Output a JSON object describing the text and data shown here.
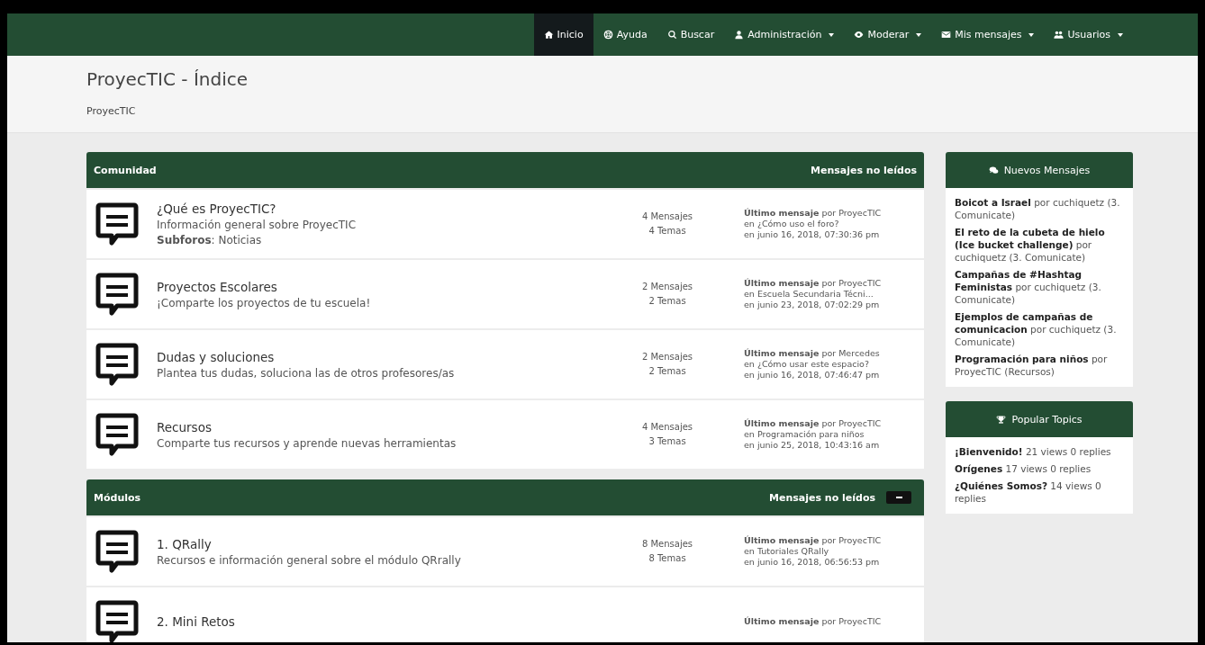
{
  "nav": {
    "items": [
      {
        "kind": "home",
        "label": "Inicio",
        "dropdown": false,
        "selected": true
      },
      {
        "kind": "lifebuoy",
        "label": "Ayuda",
        "dropdown": false,
        "selected": false
      },
      {
        "kind": "search",
        "label": "Buscar",
        "dropdown": false,
        "selected": false
      },
      {
        "kind": "user",
        "label": "Administración",
        "dropdown": true,
        "selected": false
      },
      {
        "kind": "eye",
        "label": "Moderar",
        "dropdown": true,
        "selected": false
      },
      {
        "kind": "envelope",
        "label": "Mis mensajes",
        "dropdown": true,
        "selected": false
      },
      {
        "kind": "users",
        "label": "Usuarios",
        "dropdown": true,
        "selected": false
      }
    ]
  },
  "header": {
    "title": "ProyecTIC - Índice",
    "breadcrumb": "ProyecTIC"
  },
  "categories": [
    {
      "title": "Comunidad",
      "unread_label": "Mensajes no leídos",
      "collapsible": false,
      "boards": [
        {
          "title": "¿Qué es ProyecTIC?",
          "description": "Información general sobre ProyecTIC",
          "subboards": "**Subforos**: Noticias",
          "posts": "4 Mensajes",
          "topics": "4 Temas",
          "last_post": [
            "**Último mensaje** por ProyecTIC",
            "en ¿Cómo uso el foro?",
            "en junio 16, 2018, 07:30:36 pm"
          ]
        },
        {
          "title": "Proyectos Escolares",
          "description": "¡Comparte los proyectos de tu escuela!",
          "posts": "2 Mensajes",
          "topics": "2 Temas",
          "last_post": [
            "**Último mensaje** por ProyecTIC",
            "en Escuela Secundaria Técni...",
            "en junio 23, 2018, 07:02:29 pm"
          ]
        },
        {
          "title": "Dudas y soluciones",
          "description": "Plantea tus dudas, soluciona las de otros profesores/as",
          "posts": "2 Mensajes",
          "topics": "2 Temas",
          "last_post": [
            "**Último mensaje** por Mercedes",
            "en ¿Cómo usar este espacio?",
            "en junio 16, 2018, 07:46:47 pm"
          ]
        },
        {
          "title": "Recursos",
          "description": "Comparte tus recursos y aprende nuevas herramientas",
          "posts": "4 Mensajes",
          "topics": "3 Temas",
          "last_post": [
            "**Último mensaje** por ProyecTIC",
            "en Programación para niños",
            "en junio 25, 2018, 10:43:16 am"
          ]
        }
      ]
    },
    {
      "title": "Módulos",
      "unread_label": "Mensajes no leídos",
      "collapsible": true,
      "boards": [
        {
          "title": "1. QRally",
          "description": "Recursos e información general sobre el módulo QRrally",
          "posts": "8 Mensajes",
          "topics": "8 Temas",
          "last_post": [
            "**Último mensaje** por ProyecTIC",
            "en Tutoriales QRally",
            "en junio 16, 2018, 06:56:53 pm"
          ]
        },
        {
          "title": "2. Mini Retos",
          "last_post": [
            "**Último mensaje** por ProyecTIC"
          ]
        }
      ]
    }
  ],
  "sidebar": [
    {
      "kind": "comments",
      "title": "Nuevos Mensajes",
      "items": [
        "**Boicot a Israel** por cuchiquetz (3. Comunicate)",
        "**El reto de la cubeta de hielo (Ice bucket challenge)** por cuchiquetz (3. Comunicate)",
        "**Campañas de #Hashtag Feministas** por cuchiquetz (3. Comunicate)",
        "**Ejemplos de campañas de comunicacion** por cuchiquetz (3. Comunicate)",
        "**Programación para niños** por ProyecTIC (Recursos)"
      ]
    },
    {
      "kind": "trophy",
      "title": "Popular Topics",
      "items": [
        "**¡Bienvenido!** 21 views 0 replies",
        "**Orígenes** 17 views 0 replies",
        "**¿Quiénes Somos?** 14 views 0 replies"
      ]
    }
  ]
}
